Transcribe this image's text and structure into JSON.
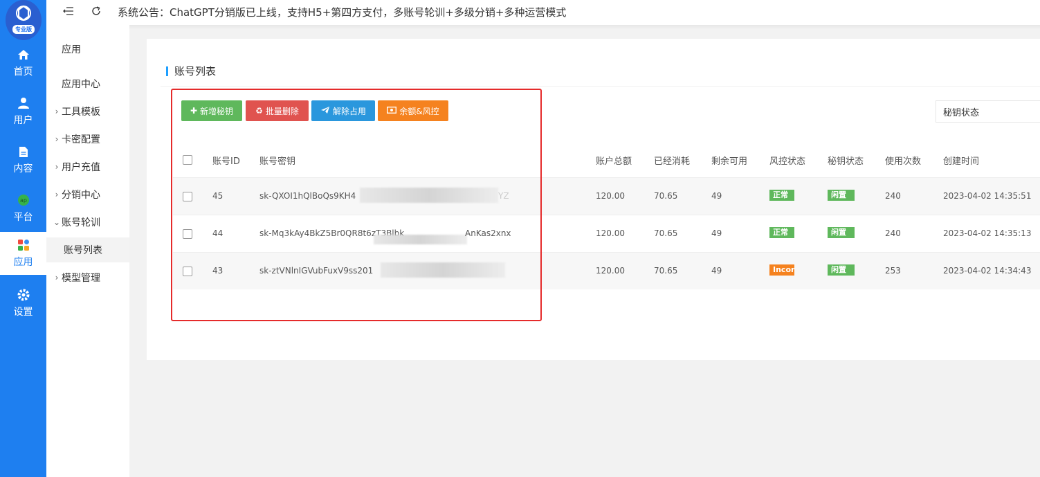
{
  "brand": {
    "badge": "专业版"
  },
  "rail": {
    "items": [
      {
        "label": "首页",
        "icon": "home-icon"
      },
      {
        "label": "用户",
        "icon": "user-icon"
      },
      {
        "label": "内容",
        "icon": "document-icon"
      },
      {
        "label": "平台",
        "icon": "platform-icon"
      },
      {
        "label": "应用",
        "icon": "apps-icon"
      },
      {
        "label": "设置",
        "icon": "gear-icon"
      }
    ]
  },
  "submenu": {
    "items": [
      {
        "label": "应用"
      },
      {
        "label": "应用中心"
      },
      {
        "label": "工具模板"
      },
      {
        "label": "卡密配置"
      },
      {
        "label": "用户充值"
      },
      {
        "label": "分销中心"
      },
      {
        "label": "账号轮训"
      },
      {
        "label": "账号列表"
      },
      {
        "label": "模型管理"
      }
    ]
  },
  "topbar": {
    "notice": "系统公告：ChatGPT分销版已上线，支持H5+第四方支付，多账号轮训+多级分销+多种运营模式"
  },
  "card": {
    "title": "账号列表",
    "buttons": {
      "add": "新增秘钥",
      "batch_delete": "批量删除",
      "release": "解除占用",
      "balance": "余额&风控"
    },
    "status_select": "秘钥状态"
  },
  "table": {
    "headers": [
      "账号ID",
      "账号密钥",
      "账户总额",
      "已经消耗",
      "剩余可用",
      "风控状态",
      "秘钥状态",
      "使用次数",
      "创建时间"
    ],
    "rows": [
      {
        "id": "45",
        "key": "sk-QXOI1hQlBoQs9KH4",
        "key_tail": "YZ",
        "total": "120.00",
        "used": "70.65",
        "remain": "49",
        "risk": "正常",
        "key_status": "闲置",
        "count": "240",
        "created": "2023-04-02 14:35:51"
      },
      {
        "id": "44",
        "key": "sk-Mq3kAy4BkZ5Br0QR8t6zT3Blbk",
        "key_tail": "AnKas2xnx",
        "total": "120.00",
        "used": "70.65",
        "remain": "49",
        "risk": "正常",
        "key_status": "闲置",
        "count": "240",
        "created": "2023-04-02 14:35:13"
      },
      {
        "id": "43",
        "key": "sk-ztVNlnIGVubFuxV9ss201",
        "key_tail": "",
        "total": "120.00",
        "used": "70.65",
        "remain": "49",
        "risk": "Incor",
        "key_status": "闲置",
        "count": "253",
        "created": "2023-04-02 14:34:43"
      }
    ]
  },
  "colors": {
    "rail_bg": "#1e7ff0",
    "ok_green": "#5fb85c",
    "warn_orange": "#f5821f",
    "highlight_red": "#e52b2b"
  }
}
